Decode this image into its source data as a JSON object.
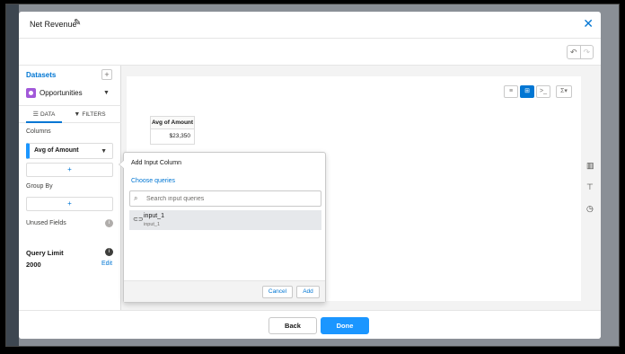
{
  "header": {
    "title": "Net Revenue"
  },
  "datasets": {
    "label": "Datasets",
    "selected": "Opportunities"
  },
  "tabs": {
    "data": "DATA",
    "filters": "FILTERS"
  },
  "columns": {
    "label": "Columns",
    "pill": "Avg of Amount"
  },
  "group_by": {
    "label": "Group By"
  },
  "unused_fields": {
    "label": "Unused Fields"
  },
  "query_limit": {
    "label": "Query Limit",
    "value": "2000",
    "edit": "Edit"
  },
  "add_plus": "+",
  "table": {
    "header": "Avg of Amount",
    "cell": "$23,350"
  },
  "popover": {
    "title": "Add Input Column",
    "subtitle": "Choose queries",
    "search_placeholder": "Search input queries",
    "item_name": "input_1",
    "item_sub": "input_1",
    "cancel": "Cancel",
    "add": "Add"
  },
  "footer": {
    "back": "Back",
    "done": "Done"
  },
  "colors": {
    "accent": "#0176d3",
    "brand_button": "#1b96ff",
    "dataset_icon": "#a259d9"
  }
}
